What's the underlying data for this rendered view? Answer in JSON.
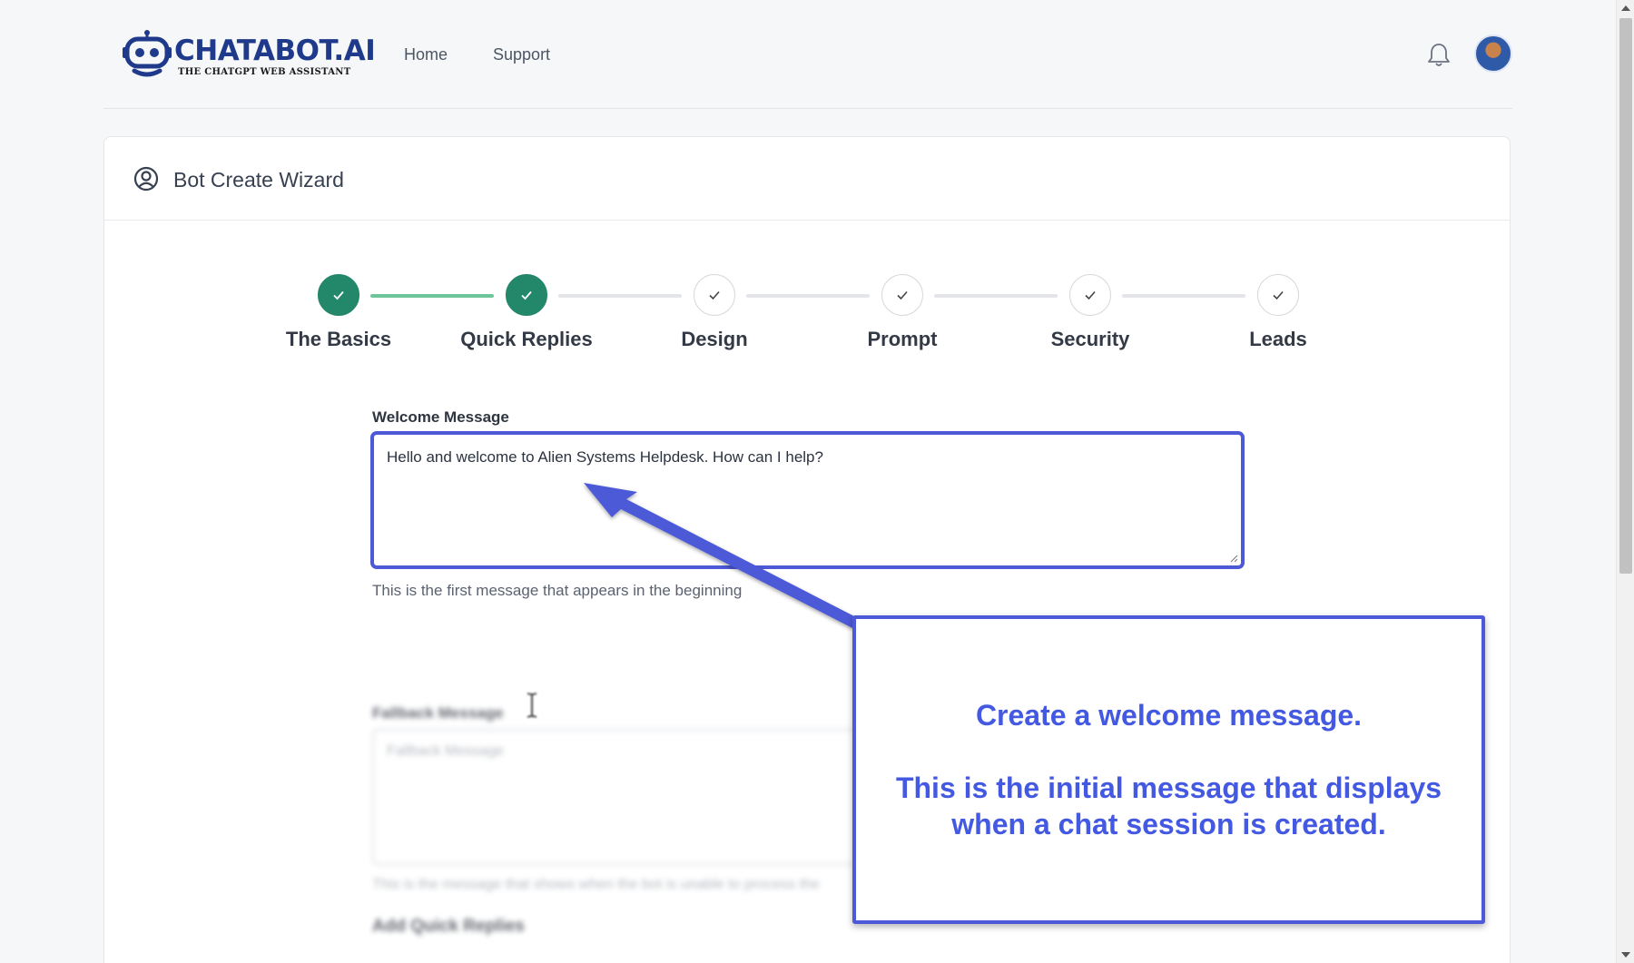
{
  "header": {
    "logo_text": "CHATABOT.AI",
    "logo_tagline": "THE CHATGPT WEB ASSISTANT",
    "nav": [
      {
        "label": "Home"
      },
      {
        "label": "Support"
      }
    ]
  },
  "card": {
    "title": "Bot Create Wizard"
  },
  "steps": [
    {
      "label": "The Basics",
      "status": "completed"
    },
    {
      "label": "Quick Replies",
      "status": "completed"
    },
    {
      "label": "Design",
      "status": "pending"
    },
    {
      "label": "Prompt",
      "status": "pending"
    },
    {
      "label": "Security",
      "status": "pending"
    },
    {
      "label": "Leads",
      "status": "pending"
    }
  ],
  "form": {
    "welcome": {
      "label": "Welcome Message",
      "value": "Hello and welcome to Alien Systems Helpdesk. How can I help?",
      "help": "This is the first message that appears in the beginning"
    },
    "fallback": {
      "label": "Fallback Message",
      "placeholder": "Fallback Message",
      "help": "This is the message that shows when the bot is unable to process the"
    },
    "quick_replies_label": "Add Quick Replies"
  },
  "callout": {
    "line1": "Create a welcome message.",
    "line2": "This is the initial message that displays when a chat session is created."
  },
  "colors": {
    "accent": "#4d5ad8",
    "step_done": "#23876a",
    "brand": "#1f3a8a",
    "callout_text": "#4459e2"
  }
}
